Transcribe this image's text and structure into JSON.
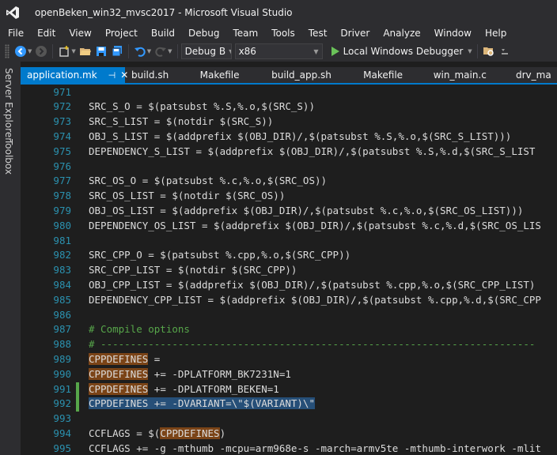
{
  "window": {
    "title": "openBeken_win32_mvsc2017 - Microsoft Visual Studio"
  },
  "menu": [
    "File",
    "Edit",
    "View",
    "Project",
    "Build",
    "Debug",
    "Team",
    "Tools",
    "Test",
    "Driver",
    "Analyze",
    "Window",
    "Help"
  ],
  "toolbar": {
    "configuration": "Debug B",
    "platform": "x86",
    "debugger": "Local Windows Debugger"
  },
  "side_tabs": {
    "server_explorer": "Server Explorer",
    "toolbox": "Toolbox"
  },
  "tabs": [
    {
      "label": "application.mk",
      "active": true
    },
    {
      "label": "build.sh"
    },
    {
      "label": "Makefile"
    },
    {
      "label": "build_app.sh"
    },
    {
      "label": "Makefile"
    },
    {
      "label": "win_main.c"
    },
    {
      "label": "drv_ma"
    }
  ],
  "colors": {
    "accent": "#007acc",
    "line_number": "#2b91af",
    "comment": "#57a64a",
    "change_bar": "#57a64a",
    "highlight": "#7b4417",
    "selection": "#264f78"
  },
  "editor": {
    "lines": [
      {
        "n": "971",
        "segs": [
          {
            "t": ""
          }
        ]
      },
      {
        "n": "972",
        "segs": [
          {
            "t": "SRC_S_O = $(patsubst %.S,%.o,$(SRC_S))"
          }
        ]
      },
      {
        "n": "973",
        "segs": [
          {
            "t": "SRC_S_LIST = $(notdir $(SRC_S))"
          }
        ]
      },
      {
        "n": "974",
        "segs": [
          {
            "t": "OBJ_S_LIST = $(addprefix $(OBJ_DIR)/,$(patsubst %.S,%.o,$(SRC_S_LIST)))"
          }
        ]
      },
      {
        "n": "975",
        "segs": [
          {
            "t": "DEPENDENCY_S_LIST = $(addprefix $(OBJ_DIR)/,$(patsubst %.S,%.d,$(SRC_S_LIST"
          }
        ]
      },
      {
        "n": "976",
        "segs": [
          {
            "t": ""
          }
        ]
      },
      {
        "n": "977",
        "segs": [
          {
            "t": "SRC_OS_O = $(patsubst %.c,%.o,$(SRC_OS))"
          }
        ]
      },
      {
        "n": "978",
        "segs": [
          {
            "t": "SRC_OS_LIST = $(notdir $(SRC_OS))"
          }
        ]
      },
      {
        "n": "979",
        "segs": [
          {
            "t": "OBJ_OS_LIST = $(addprefix $(OBJ_DIR)/,$(patsubst %.c,%.o,$(SRC_OS_LIST)))"
          }
        ]
      },
      {
        "n": "980",
        "segs": [
          {
            "t": "DEPENDENCY_OS_LIST = $(addprefix $(OBJ_DIR)/,$(patsubst %.c,%.d,$(SRC_OS_LIS"
          }
        ]
      },
      {
        "n": "981",
        "segs": [
          {
            "t": ""
          }
        ]
      },
      {
        "n": "982",
        "segs": [
          {
            "t": "SRC_CPP_O = $(patsubst %.cpp,%.o,$(SRC_CPP))"
          }
        ]
      },
      {
        "n": "983",
        "segs": [
          {
            "t": "SRC_CPP_LIST = $(notdir $(SRC_CPP))"
          }
        ]
      },
      {
        "n": "984",
        "segs": [
          {
            "t": "OBJ_CPP_LIST = $(addprefix $(OBJ_DIR)/,$(patsubst %.cpp,%.o,$(SRC_CPP_LIST)"
          }
        ]
      },
      {
        "n": "985",
        "segs": [
          {
            "t": "DEPENDENCY_CPP_LIST = $(addprefix $(OBJ_DIR)/,$(patsubst %.cpp,%.d,$(SRC_CPP"
          }
        ]
      },
      {
        "n": "986",
        "segs": [
          {
            "t": ""
          }
        ]
      },
      {
        "n": "987",
        "segs": [
          {
            "t": "# Compile options",
            "k": "c"
          }
        ]
      },
      {
        "n": "988",
        "segs": [
          {
            "t": "# -------------------------------------------------------------------------",
            "k": "c"
          }
        ]
      },
      {
        "n": "989",
        "segs": [
          {
            "t": "CPPDEFINES",
            "k": "hl"
          },
          {
            "t": " ="
          }
        ]
      },
      {
        "n": "990",
        "segs": [
          {
            "t": "CPPDEFINES",
            "k": "hl"
          },
          {
            "t": " += -DPLATFORM_BK7231N=1"
          }
        ]
      },
      {
        "n": "991",
        "changed": true,
        "segs": [
          {
            "t": "CPPDEFINES",
            "k": "hl"
          },
          {
            "t": " += -DPLATFORM_BEKEN=1"
          }
        ]
      },
      {
        "n": "992",
        "changed": true,
        "segs": [
          {
            "t": "CPPDEFINES",
            "k": "hl sel"
          },
          {
            "t": " += -DVARIANT=\\\"$(VARIANT)\\\"",
            "k": "sel"
          }
        ]
      },
      {
        "n": "993",
        "segs": [
          {
            "t": ""
          }
        ]
      },
      {
        "n": "994",
        "segs": [
          {
            "t": "CCFLAGS = $("
          },
          {
            "t": "CPPDEFINES",
            "k": "hl"
          },
          {
            "t": ")"
          }
        ]
      },
      {
        "n": "995",
        "segs": [
          {
            "t": "CCFLAGS += -g -mthumb -mcpu=arm968e-s -march=armv5te -mthumb-interwork -mlit"
          }
        ]
      }
    ]
  }
}
